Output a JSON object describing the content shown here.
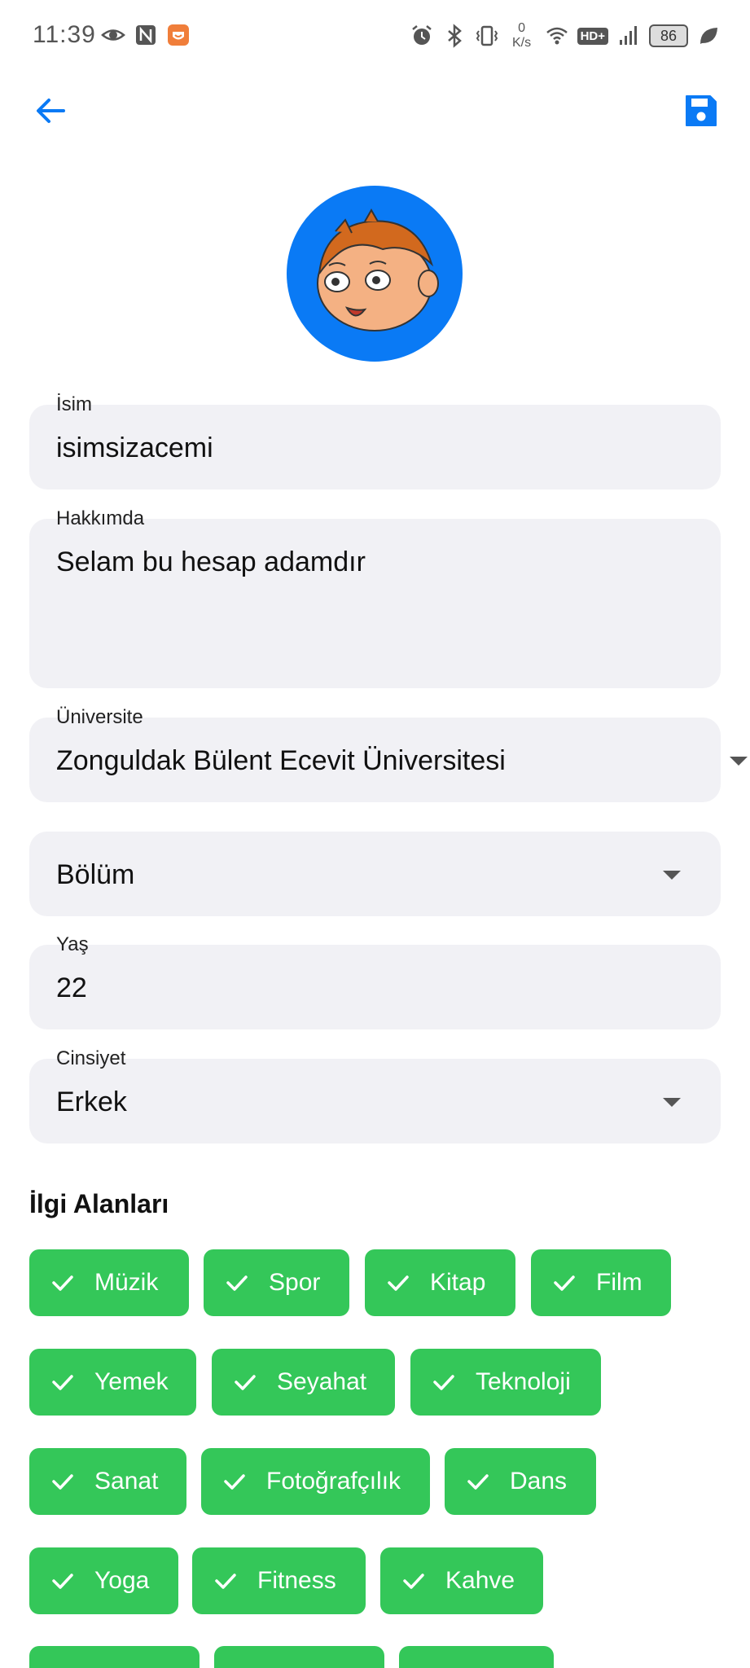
{
  "status_bar": {
    "time": "11:39",
    "speed_value": "0",
    "speed_unit": "K/s",
    "network_badge": "HD+",
    "battery": "86"
  },
  "profile_form": {
    "name": {
      "label": "İsim",
      "value": "isimsizacemi"
    },
    "about": {
      "label": "Hakkımda",
      "value": "Selam bu hesap adamdır"
    },
    "university": {
      "label": "Üniversite",
      "value": "Zonguldak Bülent Ecevit Üniversitesi"
    },
    "department": {
      "placeholder": "Bölüm"
    },
    "age": {
      "label": "Yaş",
      "value": "22"
    },
    "gender": {
      "label": "Cinsiyet",
      "value": "Erkek"
    }
  },
  "interests": {
    "title": "İlgi Alanları",
    "accent_color": "#34c759",
    "chips": [
      {
        "label": "Müzik",
        "selected": true
      },
      {
        "label": "Spor",
        "selected": true
      },
      {
        "label": "Kitap",
        "selected": true
      },
      {
        "label": "Film",
        "selected": true
      },
      {
        "label": "Yemek",
        "selected": true
      },
      {
        "label": "Seyahat",
        "selected": true
      },
      {
        "label": "Teknoloji",
        "selected": true
      },
      {
        "label": "Sanat",
        "selected": true
      },
      {
        "label": "Fotoğrafçılık",
        "selected": true
      },
      {
        "label": "Dans",
        "selected": true
      },
      {
        "label": "Yoga",
        "selected": true
      },
      {
        "label": "Fitness",
        "selected": true
      },
      {
        "label": "Kahve",
        "selected": true
      }
    ]
  },
  "colors": {
    "primary": "#0a7af5",
    "field_background": "#f1f1f5"
  }
}
